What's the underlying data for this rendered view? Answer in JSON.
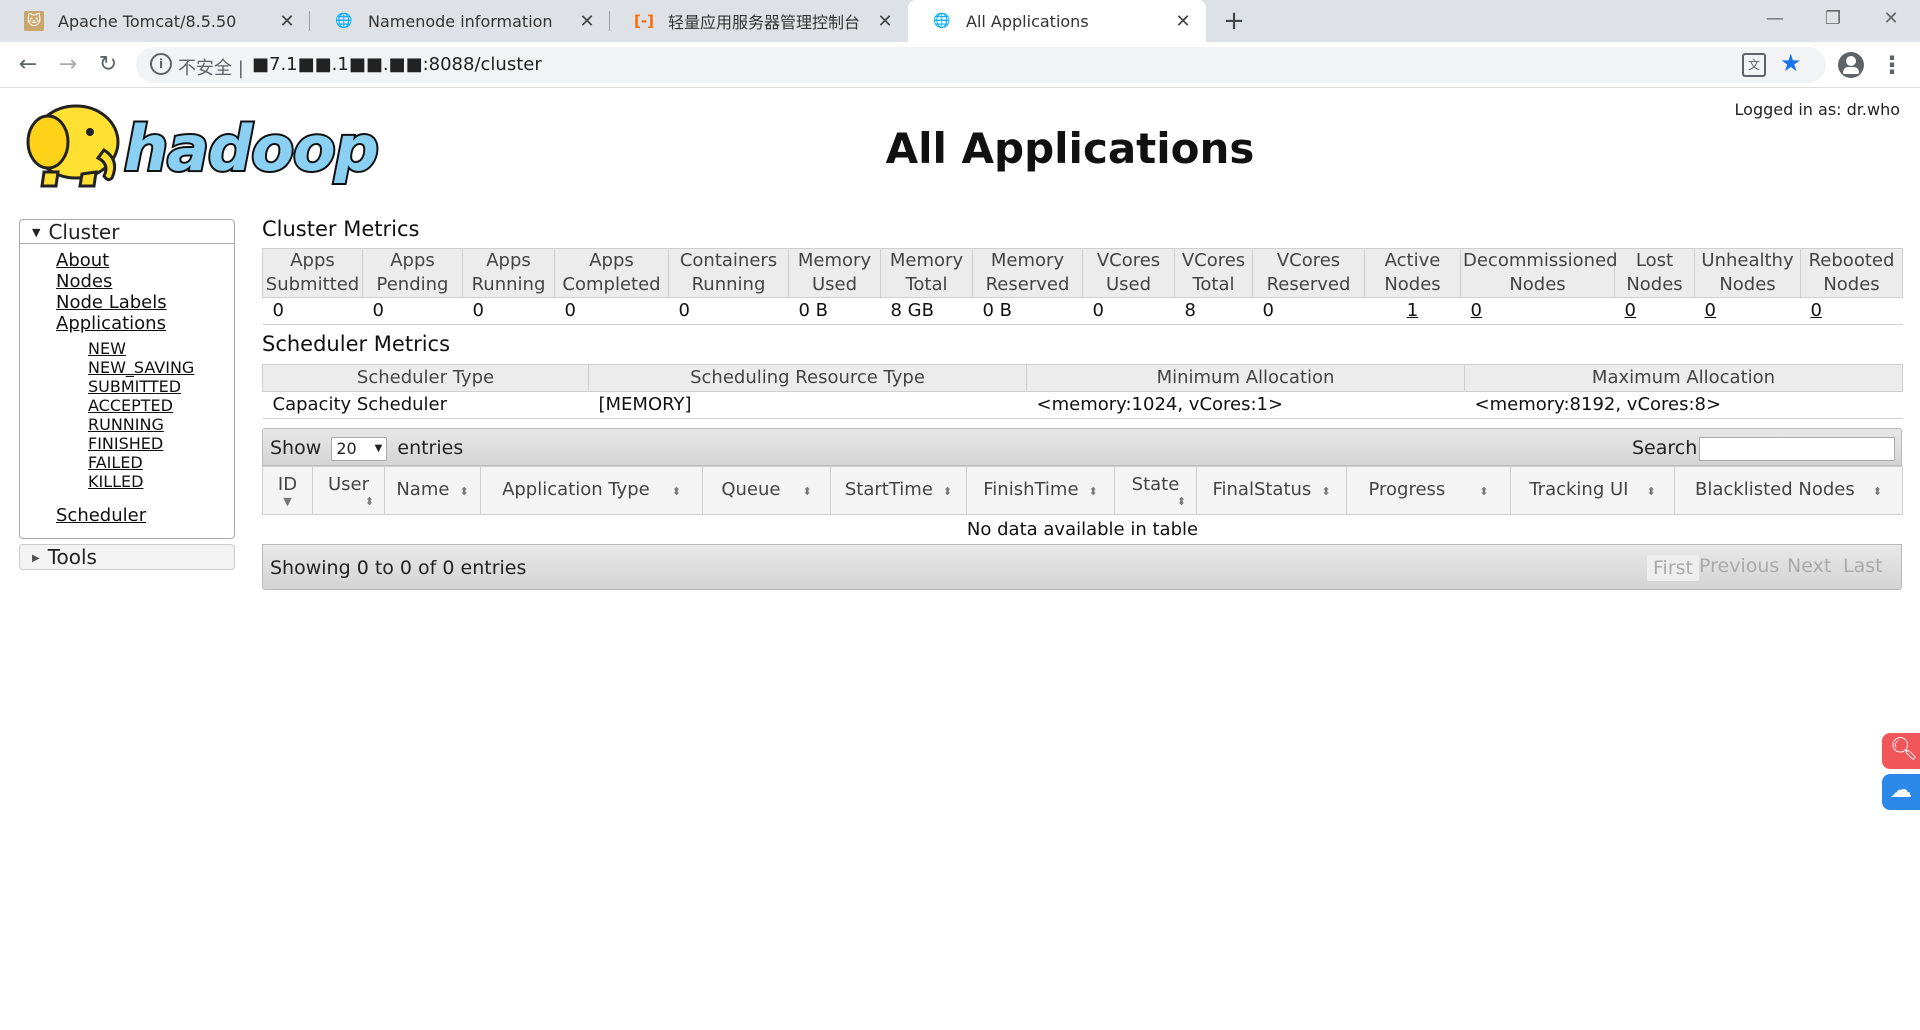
{
  "browser": {
    "tabs": [
      {
        "title": "Apache Tomcat/8.5.50",
        "icon": "tomcat-icon"
      },
      {
        "title": "Namenode information",
        "icon": "globe-icon"
      },
      {
        "title": "轻量应用服务器管理控制台",
        "icon": "aliyun-icon"
      },
      {
        "title": "All Applications",
        "icon": "globe-icon"
      }
    ],
    "url_prefix": "不安全 |",
    "url": "■7.1■■.1■■.■■:8088/cluster"
  },
  "header": {
    "logged_in": "Logged in as: dr.who",
    "title": "All Applications",
    "logo_text": "hadoop"
  },
  "nav": {
    "cluster_label": "Cluster",
    "links": [
      "About",
      "Nodes",
      "Node Labels",
      "Applications"
    ],
    "app_states": [
      "NEW",
      "NEW_SAVING",
      "SUBMITTED",
      "ACCEPTED",
      "RUNNING",
      "FINISHED",
      "FAILED",
      "KILLED"
    ],
    "scheduler": "Scheduler",
    "tools_label": "Tools"
  },
  "cluster_metrics": {
    "title": "Cluster Metrics",
    "headers": [
      [
        "Apps",
        "Submitted"
      ],
      [
        "Apps",
        "Pending"
      ],
      [
        "Apps",
        "Running"
      ],
      [
        "Apps",
        "Completed"
      ],
      [
        "Containers",
        "Running"
      ],
      [
        "Memory",
        "Used"
      ],
      [
        "Memory",
        "Total"
      ],
      [
        "Memory",
        "Reserved"
      ],
      [
        "VCores",
        "Used"
      ],
      [
        "VCores",
        "Total"
      ],
      [
        "VCores",
        "Reserved"
      ],
      [
        "Active",
        "Nodes"
      ],
      [
        "Decommissioned",
        "Nodes"
      ],
      [
        "Lost",
        "Nodes"
      ],
      [
        "Unhealthy",
        "Nodes"
      ],
      [
        "Rebooted",
        "Nodes"
      ]
    ],
    "values": [
      "0",
      "0",
      "0",
      "0",
      "0",
      "0 B",
      "8 GB",
      "0 B",
      "0",
      "8",
      "0",
      "1",
      "0",
      "0",
      "0",
      "0"
    ]
  },
  "scheduler_metrics": {
    "title": "Scheduler Metrics",
    "headers": [
      "Scheduler Type",
      "Scheduling Resource Type",
      "Minimum Allocation",
      "Maximum Allocation"
    ],
    "values": [
      "Capacity Scheduler",
      "[MEMORY]",
      "<memory:1024, vCores:1>",
      "<memory:8192, vCores:8>"
    ]
  },
  "apps_table": {
    "show_label": "Show",
    "page_size": "20",
    "entries_label": "entries",
    "search_label": "Search:",
    "columns": [
      "ID",
      "User",
      "Name",
      "Application Type",
      "Queue",
      "StartTime",
      "FinishTime",
      "State",
      "FinalStatus",
      "Progress",
      "Tracking UI",
      "Blacklisted Nodes"
    ],
    "empty_message": "No data available in table",
    "info": "Showing 0 to 0 of 0 entries",
    "pager": [
      "First",
      "Previous",
      "Next",
      "Last"
    ]
  },
  "colors": {
    "accent": "#1a73e8",
    "side_search": "#f0565a",
    "side_cloud": "#2a88e8"
  }
}
